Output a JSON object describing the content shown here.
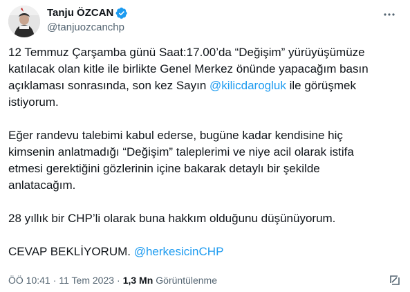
{
  "author": {
    "display_name": "Tanju ÖZCAN",
    "handle": "@tanjuozcanchp",
    "verified": true
  },
  "tweet": {
    "p1_before": "12 Temmuz Çarşamba günü Saat:17.00’da “Değişim” yürüyüşümüze katılacak olan kitle ile birlikte Genel Merkez önünde yapacağım basın açıklaması sonrasında, son kez Sayın ",
    "p1_mention": "@kilicdarogluk",
    "p1_after": " ile görüşmek istiyorum.",
    "p2": "Eğer randevu talebimi kabul ederse, bugüne kadar kendisine hiç kimsenin anlatmadığı “Değişim” taleplerimi ve niye acil olarak istifa etmesi gerektiğini gözlerinin içine bakarak detaylı bir şekilde anlatacağım.",
    "p3": "28 yıllık bir CHP’li olarak buna hakkım olduğunu düşünüyorum.",
    "p4_before": "CEVAP BEKLİYORUM. ",
    "p4_mention": "@herkesicinCHP"
  },
  "meta": {
    "time": "ÖÖ 10:41",
    "date": "11 Tem 2023",
    "separator": "·",
    "views_count": "1,3 Mn",
    "views_label": "Görüntülenme"
  },
  "colors": {
    "link": "#1d9bf0",
    "secondary_text": "#536471",
    "primary_text": "#0f1419",
    "verified": "#1d9bf0"
  },
  "icons": [
    "verified-badge-icon",
    "more-icon",
    "grok-icon"
  ]
}
